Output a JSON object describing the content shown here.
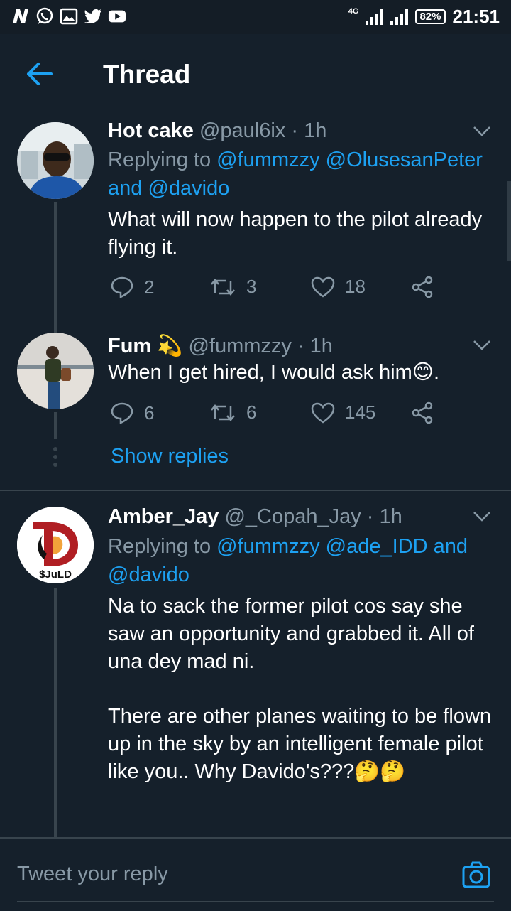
{
  "status_bar": {
    "network": "4G",
    "battery": "82%",
    "time": "21:51",
    "icons": [
      "n-app-icon",
      "whatsapp-icon",
      "gallery-icon",
      "twitter-icon",
      "youtube-icon"
    ]
  },
  "header": {
    "back_icon": "arrow-left-icon",
    "title": "Thread"
  },
  "tweets": [
    {
      "name": "Hot cake",
      "handle": "@paul6ix",
      "time": "· 1h",
      "replying_prefix": "Replying to",
      "replying_line1": "@fummzzy @OlusesanPeter",
      "replying_and": "and",
      "replying_line2": "@davido",
      "body": "What will now happen to the pilot already flying it.",
      "replies": "2",
      "retweets": "3",
      "likes": "18"
    },
    {
      "name": "Fum",
      "emoji_after_name": "💫",
      "handle": "@fummzzy",
      "time": "· 1h",
      "body": "When I get hired, I would ask him😊.",
      "replies": "6",
      "retweets": "6",
      "likes": "145"
    },
    {
      "name": "Amber_Jay",
      "handle": "@_Copah_Jay",
      "time": "· 1h",
      "avatar_text": "$JuLD",
      "replying_prefix": "Replying to",
      "replying_line1": "@fummzzy @ade_IDD",
      "replying_and": "and",
      "replying_line2": "@davido",
      "body_p1": "Na to sack the former pilot cos say she saw an opportunity and grabbed it. All of una dey mad ni.",
      "body_p2": "There are other planes waiting to be flown up in the sky by an intelligent female pilot like you.. Why Davido's???🤔🤔"
    }
  ],
  "show_replies": "Show replies",
  "composer": {
    "placeholder": "Tweet your reply",
    "camera_icon": "camera-icon"
  },
  "colors": {
    "background": "#15202b",
    "accent": "#1da1f2",
    "secondary_text": "#8899a6",
    "divider": "#38444d"
  }
}
